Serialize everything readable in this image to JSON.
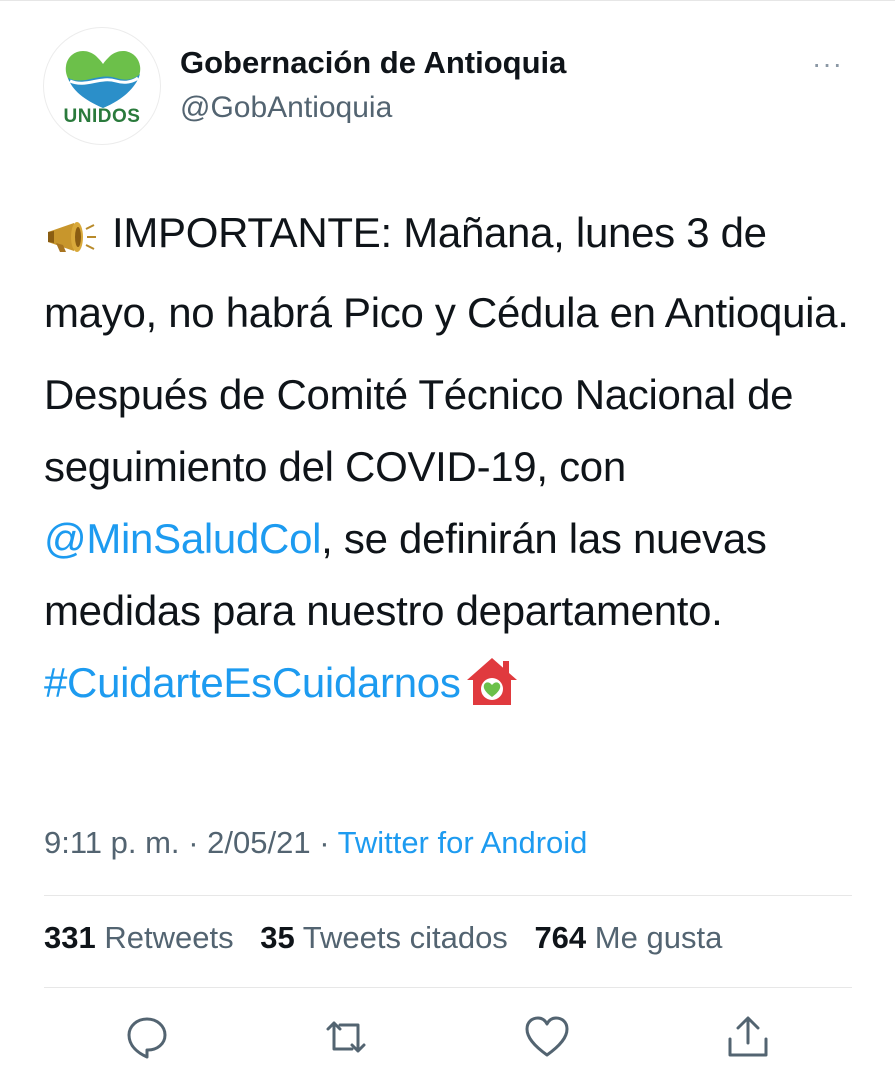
{
  "profile": {
    "display_name": "Gobernación de Antioquia",
    "handle": "@GobAntioquia",
    "avatar_text": "UNIDOS",
    "avatar_icon": "heart-logo",
    "more_icon": "···"
  },
  "tweet": {
    "para1_emoji": "megaphone",
    "para1_text": "IMPORTANTE: Mañana, lunes 3 de mayo, no habrá Pico y Cédula en Antioquia.",
    "para2_text_a": "Después de Comité Técnico Nacional de seguimiento del COVID-19, con ",
    "mention": "@MinSaludCol",
    "para2_text_b": ", se definirán las nuevas medidas para nuestro departamento.",
    "hashtag": "#CuidarteEsCuidarnos",
    "hashtag_emoji": "house-with-heart"
  },
  "meta": {
    "time": "9:11 p. m.",
    "separator": "·",
    "date": "2/05/21",
    "source": "Twitter for Android"
  },
  "stats": {
    "retweets_count": "331",
    "retweets_label": "Retweets",
    "quotes_count": "35",
    "quotes_label": "Tweets citados",
    "likes_count": "764",
    "likes_label": "Me gusta"
  },
  "actions": [
    "reply-icon",
    "retweet-icon",
    "like-icon",
    "share-icon"
  ],
  "colors": {
    "link": "#1d9bf0",
    "secondary": "#536471",
    "text": "#0f1419",
    "avatar_green": "#6cc04a",
    "avatar_blue": "#2b8fc9"
  }
}
